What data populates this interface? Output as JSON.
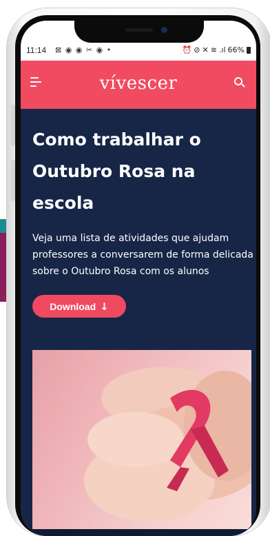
{
  "status_bar": {
    "time": "11:14",
    "left_icons": "⊠ ◉ ◉ ✂ ◉ •",
    "right_icons": [
      "⏰",
      "⊘",
      "✕",
      "≋",
      ".ıl"
    ],
    "battery": "66%"
  },
  "app_bar": {
    "logo": "vívescer",
    "menu_icon": "hamburger-menu-icon",
    "search_icon": "search-icon",
    "background_color": "#f14b62"
  },
  "article": {
    "title": "Como trabalhar o Outubro Rosa na escola",
    "description": "Veja uma lista de atividades que ajudam professores a conversarem de forma delicada sobre o Outubro Rosa com os alunos",
    "download_label": "Download",
    "download_icon": "↓",
    "background_color": "#172646",
    "button_color": "#ef4a60"
  }
}
